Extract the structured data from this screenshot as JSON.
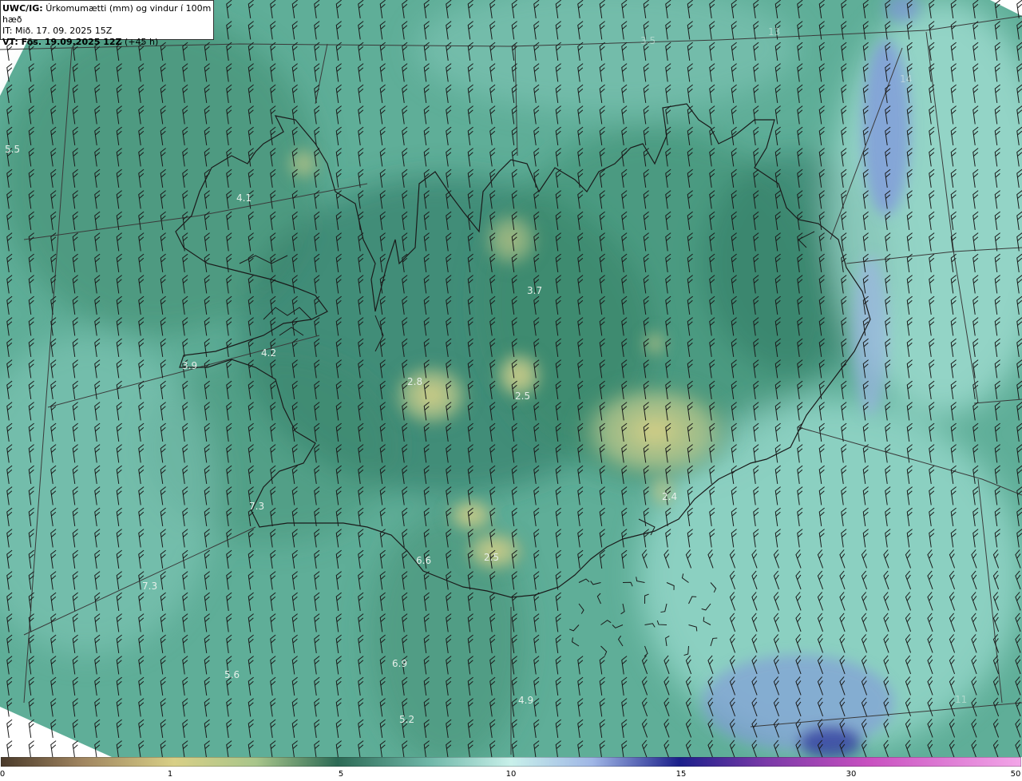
{
  "header": {
    "model": "UWC/IG:",
    "title": "Úrkomumætti (mm) og vindur í 100m hæð",
    "issue_time": "IT: Mið. 17. 09. 2025 15Z",
    "valid_prefix": "VT: Fös. 19.09.2025 12Z",
    "valid_suffix": "(+45 h)"
  },
  "map": {
    "value_labels": [
      {
        "text": "5.5"
      },
      {
        "text": "4.1"
      },
      {
        "text": "3.7"
      },
      {
        "text": "4.2"
      },
      {
        "text": "3.9"
      },
      {
        "text": "2.8"
      },
      {
        "text": "2.5"
      },
      {
        "text": "2.4"
      },
      {
        "text": "2.5"
      },
      {
        "text": "6.6"
      },
      {
        "text": "7.3"
      },
      {
        "text": "7.3"
      },
      {
        "text": "6.9"
      },
      {
        "text": "5.6"
      },
      {
        "text": "4.9"
      },
      {
        "text": "5.2"
      },
      {
        "text": "3.5"
      },
      {
        "text": "13"
      },
      {
        "text": "14"
      },
      {
        "text": "11"
      }
    ]
  },
  "colorbar": {
    "ticks": [
      "0",
      "1",
      "5",
      "10",
      "15",
      "30",
      "50"
    ],
    "colors": [
      "#4a3a2a",
      "#a08560",
      "#d8cf86",
      "#a8c58a",
      "#2c6a55",
      "#6fb7a8",
      "#c8f0ea",
      "#9fb6e6",
      "#1b1f8a",
      "#7a3aa8",
      "#c850c0",
      "#f3a6e8"
    ]
  }
}
